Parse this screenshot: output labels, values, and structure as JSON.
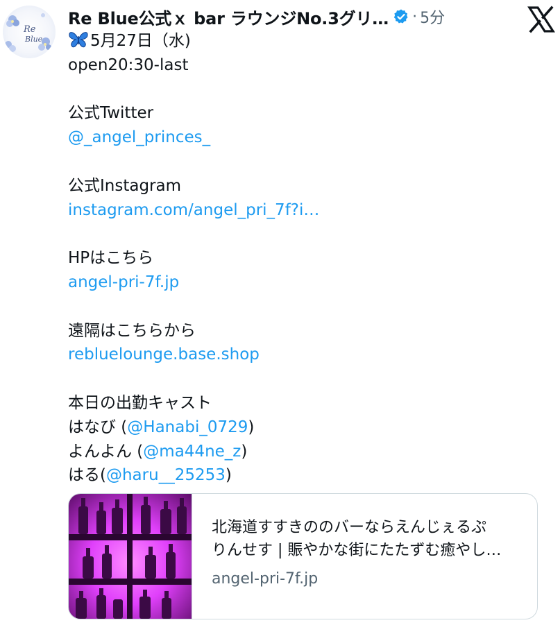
{
  "tweet": {
    "avatar": {
      "text_line1": "Re",
      "text_line2": "Blue"
    },
    "author": {
      "display_name": "Re Blue公式ｘ bar ラウンジNo.3グリ…",
      "separator": "·",
      "time": "5分"
    },
    "lines": {
      "date": "5月27日（水)",
      "open": "open20:30-last",
      "twitter_label": "公式Twitter",
      "twitter_handle": "@_angel_princes_",
      "instagram_label": "公式Instagram",
      "instagram_link": "instagram.com/angel_pri_7f?i…",
      "hp_label": "HPはこちら",
      "hp_link": "angel-pri-7f.jp",
      "remote_label": "遠隔はこちらから",
      "remote_link": "reblueloungе.base.shop",
      "cast_label": "本日の出勤キャスト",
      "cast1_name": "はなび (",
      "cast1_handle": "@Hanabi_0729",
      "cast1_close": ")",
      "cast2_name": "よんよん (",
      "cast2_handle": "@ma44ne_z",
      "cast2_close": ")",
      "cast3_name": "はる(",
      "cast3_handle": "@haru__25253",
      "cast3_close": ")"
    },
    "card": {
      "title_line1": "北海道すすきののバーならえんじぇるぷ",
      "title_line2": "りんせす | 賑やかな街にたたずむ癒やし…",
      "domain": "angel-pri-7f.jp"
    }
  },
  "colors": {
    "text": "#0f1419",
    "link": "#1d9bf0",
    "secondary": "#536471",
    "verified": "#1d9bf0",
    "border": "#cfd9de",
    "card_image_magenta": "#e040fb"
  },
  "icons": {
    "verified": "verified-badge-icon",
    "butterfly": "butterfly-emoji",
    "x_logo": "x-logo-icon"
  }
}
